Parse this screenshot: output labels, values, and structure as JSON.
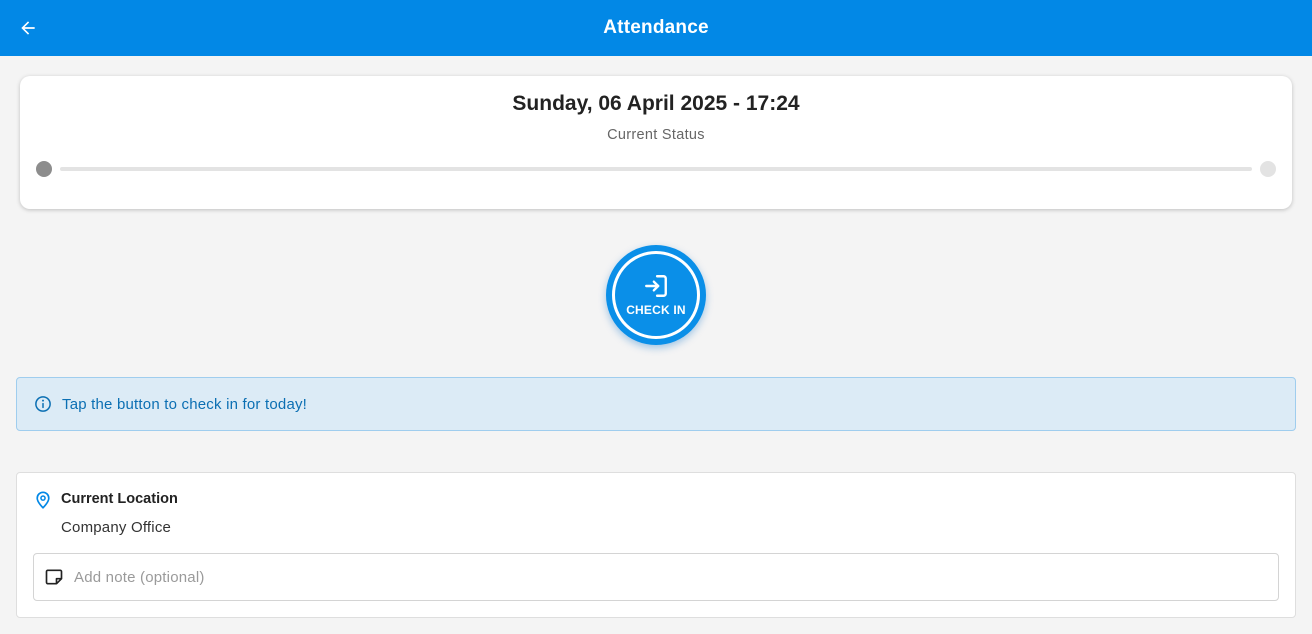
{
  "header": {
    "title": "Attendance",
    "back_icon": "arrow-left-icon"
  },
  "status_card": {
    "date_time": "Sunday, 06 April 2025 - 17:24",
    "status_label": "Current Status"
  },
  "check_in_button": {
    "label": "CHECK IN",
    "icon": "login-icon"
  },
  "info_banner": {
    "icon": "info-icon",
    "text": "Tap the button to check in for today!"
  },
  "location": {
    "icon": "map-pin-icon",
    "title": "Current Location",
    "value": "Company Office"
  },
  "note": {
    "icon": "note-icon",
    "placeholder": "Add note (optional)",
    "value": ""
  },
  "colors": {
    "primary": "#0288e6",
    "info_background": "#dcebf6",
    "info_text": "#0b6fb3"
  }
}
